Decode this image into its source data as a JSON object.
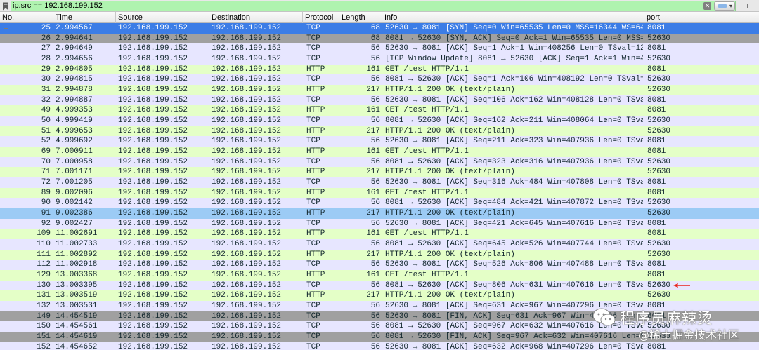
{
  "filter": {
    "value": "ip.src == 192.168.199.152",
    "clear_symbol": "✕",
    "dropdown_symbol": "▾",
    "add_symbol": "+"
  },
  "columns": [
    "No.",
    "Time",
    "Source",
    "Destination",
    "Protocol",
    "Length",
    "Info",
    "port"
  ],
  "rows": [
    {
      "no": "25",
      "time": "2.994567",
      "src": "192.168.199.152",
      "dst": "192.168.199.152",
      "proto": "TCP",
      "len": "68",
      "info": "52630 → 8081 [SYN] Seq=0 Win=65535 Len=0 MSS=16344 WS=64…",
      "port": "8081",
      "style": "sel"
    },
    {
      "no": "26",
      "time": "2.994641",
      "src": "192.168.199.152",
      "dst": "192.168.199.152",
      "proto": "TCP",
      "len": "68",
      "info": "8081 → 52630 [SYN, ACK] Seq=0 Ack=1 Win=65535 Len=0 MSS=…",
      "port": "52630",
      "style": "gray"
    },
    {
      "no": "27",
      "time": "2.994649",
      "src": "192.168.199.152",
      "dst": "192.168.199.152",
      "proto": "TCP",
      "len": "56",
      "info": "52630 → 8081 [ACK] Seq=1 Ack=1 Win=408256 Len=0 TSval=12…",
      "port": "8081",
      "style": "tcp"
    },
    {
      "no": "28",
      "time": "2.994656",
      "src": "192.168.199.152",
      "dst": "192.168.199.152",
      "proto": "TCP",
      "len": "56",
      "info": "[TCP Window Update] 8081 → 52630 [ACK] Seq=1 Ack=1 Win=4…",
      "port": "52630",
      "style": "tcp"
    },
    {
      "no": "29",
      "time": "2.994805",
      "src": "192.168.199.152",
      "dst": "192.168.199.152",
      "proto": "HTTP",
      "len": "161",
      "info": "GET /test HTTP/1.1",
      "port": "8081",
      "style": "http"
    },
    {
      "no": "30",
      "time": "2.994815",
      "src": "192.168.199.152",
      "dst": "192.168.199.152",
      "proto": "TCP",
      "len": "56",
      "info": "8081 → 52630 [ACK] Seq=1 Ack=106 Win=408192 Len=0 TSval=…",
      "port": "52630",
      "style": "tcp"
    },
    {
      "no": "31",
      "time": "2.994878",
      "src": "192.168.199.152",
      "dst": "192.168.199.152",
      "proto": "HTTP",
      "len": "217",
      "info": "HTTP/1.1 200 OK  (text/plain)",
      "port": "52630",
      "style": "http"
    },
    {
      "no": "32",
      "time": "2.994887",
      "src": "192.168.199.152",
      "dst": "192.168.199.152",
      "proto": "TCP",
      "len": "56",
      "info": "52630 → 8081 [ACK] Seq=106 Ack=162 Win=408128 Len=0 TSva…",
      "port": "8081",
      "style": "tcp"
    },
    {
      "no": "49",
      "time": "4.999353",
      "src": "192.168.199.152",
      "dst": "192.168.199.152",
      "proto": "HTTP",
      "len": "161",
      "info": "GET /test HTTP/1.1",
      "port": "8081",
      "style": "http"
    },
    {
      "no": "50",
      "time": "4.999419",
      "src": "192.168.199.152",
      "dst": "192.168.199.152",
      "proto": "TCP",
      "len": "56",
      "info": "8081 → 52630 [ACK] Seq=162 Ack=211 Win=408064 Len=0 TSva…",
      "port": "52630",
      "style": "tcp"
    },
    {
      "no": "51",
      "time": "4.999653",
      "src": "192.168.199.152",
      "dst": "192.168.199.152",
      "proto": "HTTP",
      "len": "217",
      "info": "HTTP/1.1 200 OK  (text/plain)",
      "port": "52630",
      "style": "http"
    },
    {
      "no": "52",
      "time": "4.999692",
      "src": "192.168.199.152",
      "dst": "192.168.199.152",
      "proto": "TCP",
      "len": "56",
      "info": "52630 → 8081 [ACK] Seq=211 Ack=323 Win=407936 Len=0 TSva…",
      "port": "8081",
      "style": "tcp"
    },
    {
      "no": "69",
      "time": "7.000911",
      "src": "192.168.199.152",
      "dst": "192.168.199.152",
      "proto": "HTTP",
      "len": "161",
      "info": "GET /test HTTP/1.1",
      "port": "8081",
      "style": "http"
    },
    {
      "no": "70",
      "time": "7.000958",
      "src": "192.168.199.152",
      "dst": "192.168.199.152",
      "proto": "TCP",
      "len": "56",
      "info": "8081 → 52630 [ACK] Seq=323 Ack=316 Win=407936 Len=0 TSva…",
      "port": "52630",
      "style": "tcp"
    },
    {
      "no": "71",
      "time": "7.001171",
      "src": "192.168.199.152",
      "dst": "192.168.199.152",
      "proto": "HTTP",
      "len": "217",
      "info": "HTTP/1.1 200 OK  (text/plain)",
      "port": "52630",
      "style": "http"
    },
    {
      "no": "72",
      "time": "7.001205",
      "src": "192.168.199.152",
      "dst": "192.168.199.152",
      "proto": "TCP",
      "len": "56",
      "info": "52630 → 8081 [ACK] Seq=316 Ack=484 Win=407808 Len=0 TSva…",
      "port": "8081",
      "style": "tcp"
    },
    {
      "no": "89",
      "time": "9.002096",
      "src": "192.168.199.152",
      "dst": "192.168.199.152",
      "proto": "HTTP",
      "len": "161",
      "info": "GET /test HTTP/1.1",
      "port": "8081",
      "style": "http"
    },
    {
      "no": "90",
      "time": "9.002142",
      "src": "192.168.199.152",
      "dst": "192.168.199.152",
      "proto": "TCP",
      "len": "56",
      "info": "8081 → 52630 [ACK] Seq=484 Ack=421 Win=407872 Len=0 TSva…",
      "port": "52630",
      "style": "tcp"
    },
    {
      "no": "91",
      "time": "9.002386",
      "src": "192.168.199.152",
      "dst": "192.168.199.152",
      "proto": "HTTP",
      "len": "217",
      "info": "HTTP/1.1 200 OK  (text/plain)",
      "port": "52630",
      "style": "highlight"
    },
    {
      "no": "92",
      "time": "9.002427",
      "src": "192.168.199.152",
      "dst": "192.168.199.152",
      "proto": "TCP",
      "len": "56",
      "info": "52630 → 8081 [ACK] Seq=421 Ack=645 Win=407616 Len=0 TSva…",
      "port": "8081",
      "style": "tcp"
    },
    {
      "no": "109",
      "time": "11.002691",
      "src": "192.168.199.152",
      "dst": "192.168.199.152",
      "proto": "HTTP",
      "len": "161",
      "info": "GET /test HTTP/1.1",
      "port": "8081",
      "style": "http"
    },
    {
      "no": "110",
      "time": "11.002733",
      "src": "192.168.199.152",
      "dst": "192.168.199.152",
      "proto": "TCP",
      "len": "56",
      "info": "8081 → 52630 [ACK] Seq=645 Ack=526 Win=407744 Len=0 TSva…",
      "port": "52630",
      "style": "tcp"
    },
    {
      "no": "111",
      "time": "11.002892",
      "src": "192.168.199.152",
      "dst": "192.168.199.152",
      "proto": "HTTP",
      "len": "217",
      "info": "HTTP/1.1 200 OK  (text/plain)",
      "port": "52630",
      "style": "http"
    },
    {
      "no": "112",
      "time": "11.002918",
      "src": "192.168.199.152",
      "dst": "192.168.199.152",
      "proto": "TCP",
      "len": "56",
      "info": "52630 → 8081 [ACK] Seq=526 Ack=806 Win=407488 Len=0 TSva…",
      "port": "8081",
      "style": "tcp"
    },
    {
      "no": "129",
      "time": "13.003368",
      "src": "192.168.199.152",
      "dst": "192.168.199.152",
      "proto": "HTTP",
      "len": "161",
      "info": "GET /test HTTP/1.1",
      "port": "8081",
      "style": "http"
    },
    {
      "no": "130",
      "time": "13.003395",
      "src": "192.168.199.152",
      "dst": "192.168.199.152",
      "proto": "TCP",
      "len": "56",
      "info": "8081 → 52630 [ACK] Seq=806 Ack=631 Win=407616 Len=0 TSva…",
      "port": "52630",
      "style": "tcp"
    },
    {
      "no": "131",
      "time": "13.003519",
      "src": "192.168.199.152",
      "dst": "192.168.199.152",
      "proto": "HTTP",
      "len": "217",
      "info": "HTTP/1.1 200 OK  (text/plain)",
      "port": "52630",
      "style": "http"
    },
    {
      "no": "132",
      "time": "13.003531",
      "src": "192.168.199.152",
      "dst": "192.168.199.152",
      "proto": "TCP",
      "len": "56",
      "info": "52630 → 8081 [ACK] Seq=631 Ack=967 Win=407296 Len=0 TSva…",
      "port": "8081",
      "style": "tcp"
    },
    {
      "no": "149",
      "time": "14.454519",
      "src": "192.168.199.152",
      "dst": "192.168.199.152",
      "proto": "TCP",
      "len": "56",
      "info": "52630 → 8081 [FIN, ACK] Seq=631 Ack=967 Win=407296 Len=0…",
      "port": "8081",
      "style": "gray"
    },
    {
      "no": "150",
      "time": "14.454561",
      "src": "192.168.199.152",
      "dst": "192.168.199.152",
      "proto": "TCP",
      "len": "56",
      "info": "8081 → 52630 [ACK] Seq=967 Ack=632 Win=407616 Len=0 TSva…",
      "port": "52630",
      "style": "tcp"
    },
    {
      "no": "151",
      "time": "14.454619",
      "src": "192.168.199.152",
      "dst": "192.168.199.152",
      "proto": "TCP",
      "len": "56",
      "info": "8081 → 52630 [FIN, ACK] Seq=967 Ack=632 Win=407616 Len=0…",
      "port": "52630",
      "style": "gray"
    },
    {
      "no": "152",
      "time": "14.454652",
      "src": "192.168.199.152",
      "dst": "192.168.199.152",
      "proto": "TCP",
      "len": "56",
      "info": "52630 → 8081 [ACK] Seq=632 Ack=968 Win=407296 Len=0 TSva…",
      "port": "8081",
      "style": "tcp"
    }
  ],
  "watermark": {
    "line1": "程序员麻辣烫",
    "line2": "@稀土掘金技术社区"
  },
  "colors": {
    "filter_valid": "#aff3af",
    "tcp_row": "#e7e6ff",
    "http_row": "#e4ffc7",
    "selected_row": "#3c7de6",
    "gray_row": "#a0a0a0",
    "highlight_row": "#9ccbf5",
    "annotation_arrow": "#e8241c"
  }
}
